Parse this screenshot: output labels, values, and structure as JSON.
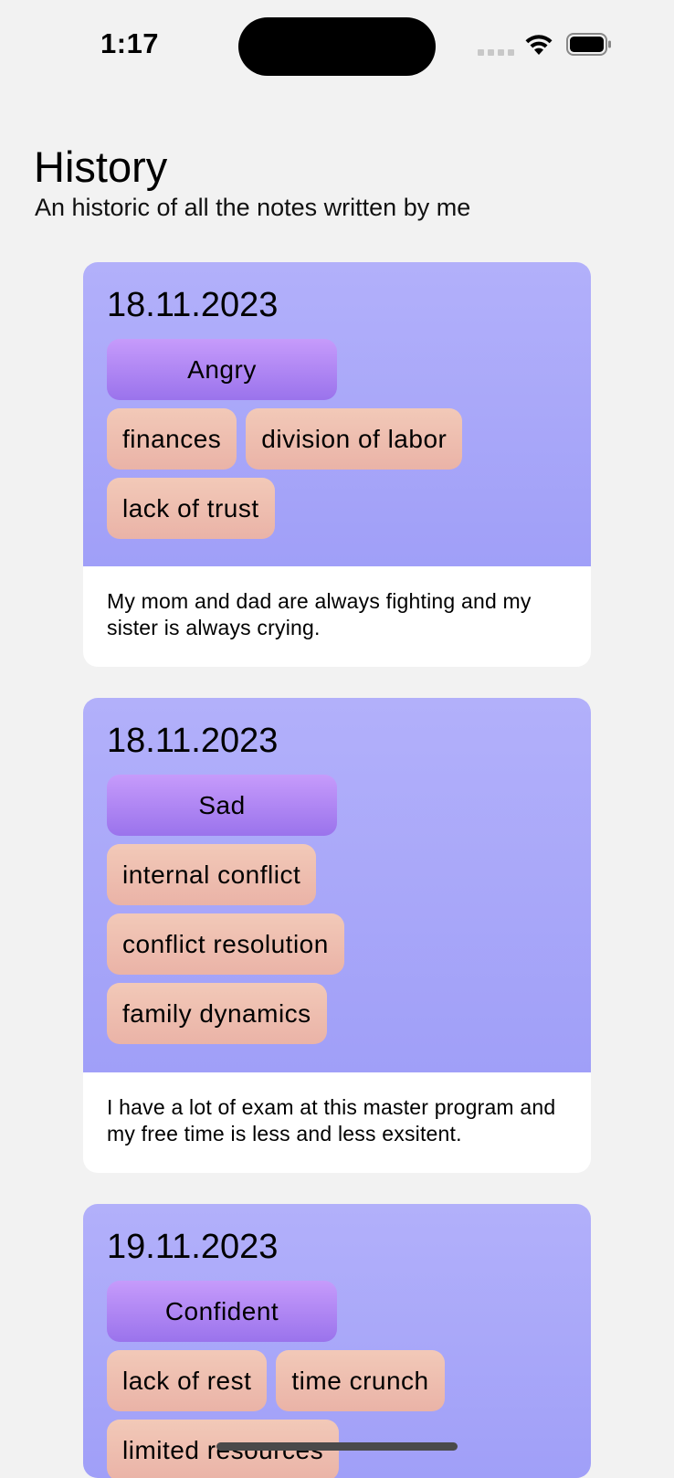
{
  "status_bar": {
    "time": "1:17"
  },
  "header": {
    "title": "History",
    "subtitle": "An historic of all the notes written by me"
  },
  "colors": {
    "background": "#f2f2f2",
    "card_gradient_top": "#b2b0fa",
    "card_gradient_bottom": "#a09ff8",
    "emotion_chip": "#a57ef0",
    "tag_chip": "#efbfb0"
  },
  "entries": [
    {
      "date": "18.11.2023",
      "emotion": "Angry",
      "tags": [
        "finances",
        "division of labor",
        "lack of trust"
      ],
      "note": "My mom and dad are always fighting and my sister is always crying."
    },
    {
      "date": "18.11.2023",
      "emotion": "Sad",
      "tags": [
        "internal conflict",
        "conflict resolution",
        "family dynamics"
      ],
      "note": "I have a lot of exam at this master program and my free time is less and less exsitent."
    },
    {
      "date": "19.11.2023",
      "emotion": "Confident",
      "tags": [
        "lack of rest",
        "time crunch",
        "limited resources"
      ],
      "note": ""
    }
  ]
}
